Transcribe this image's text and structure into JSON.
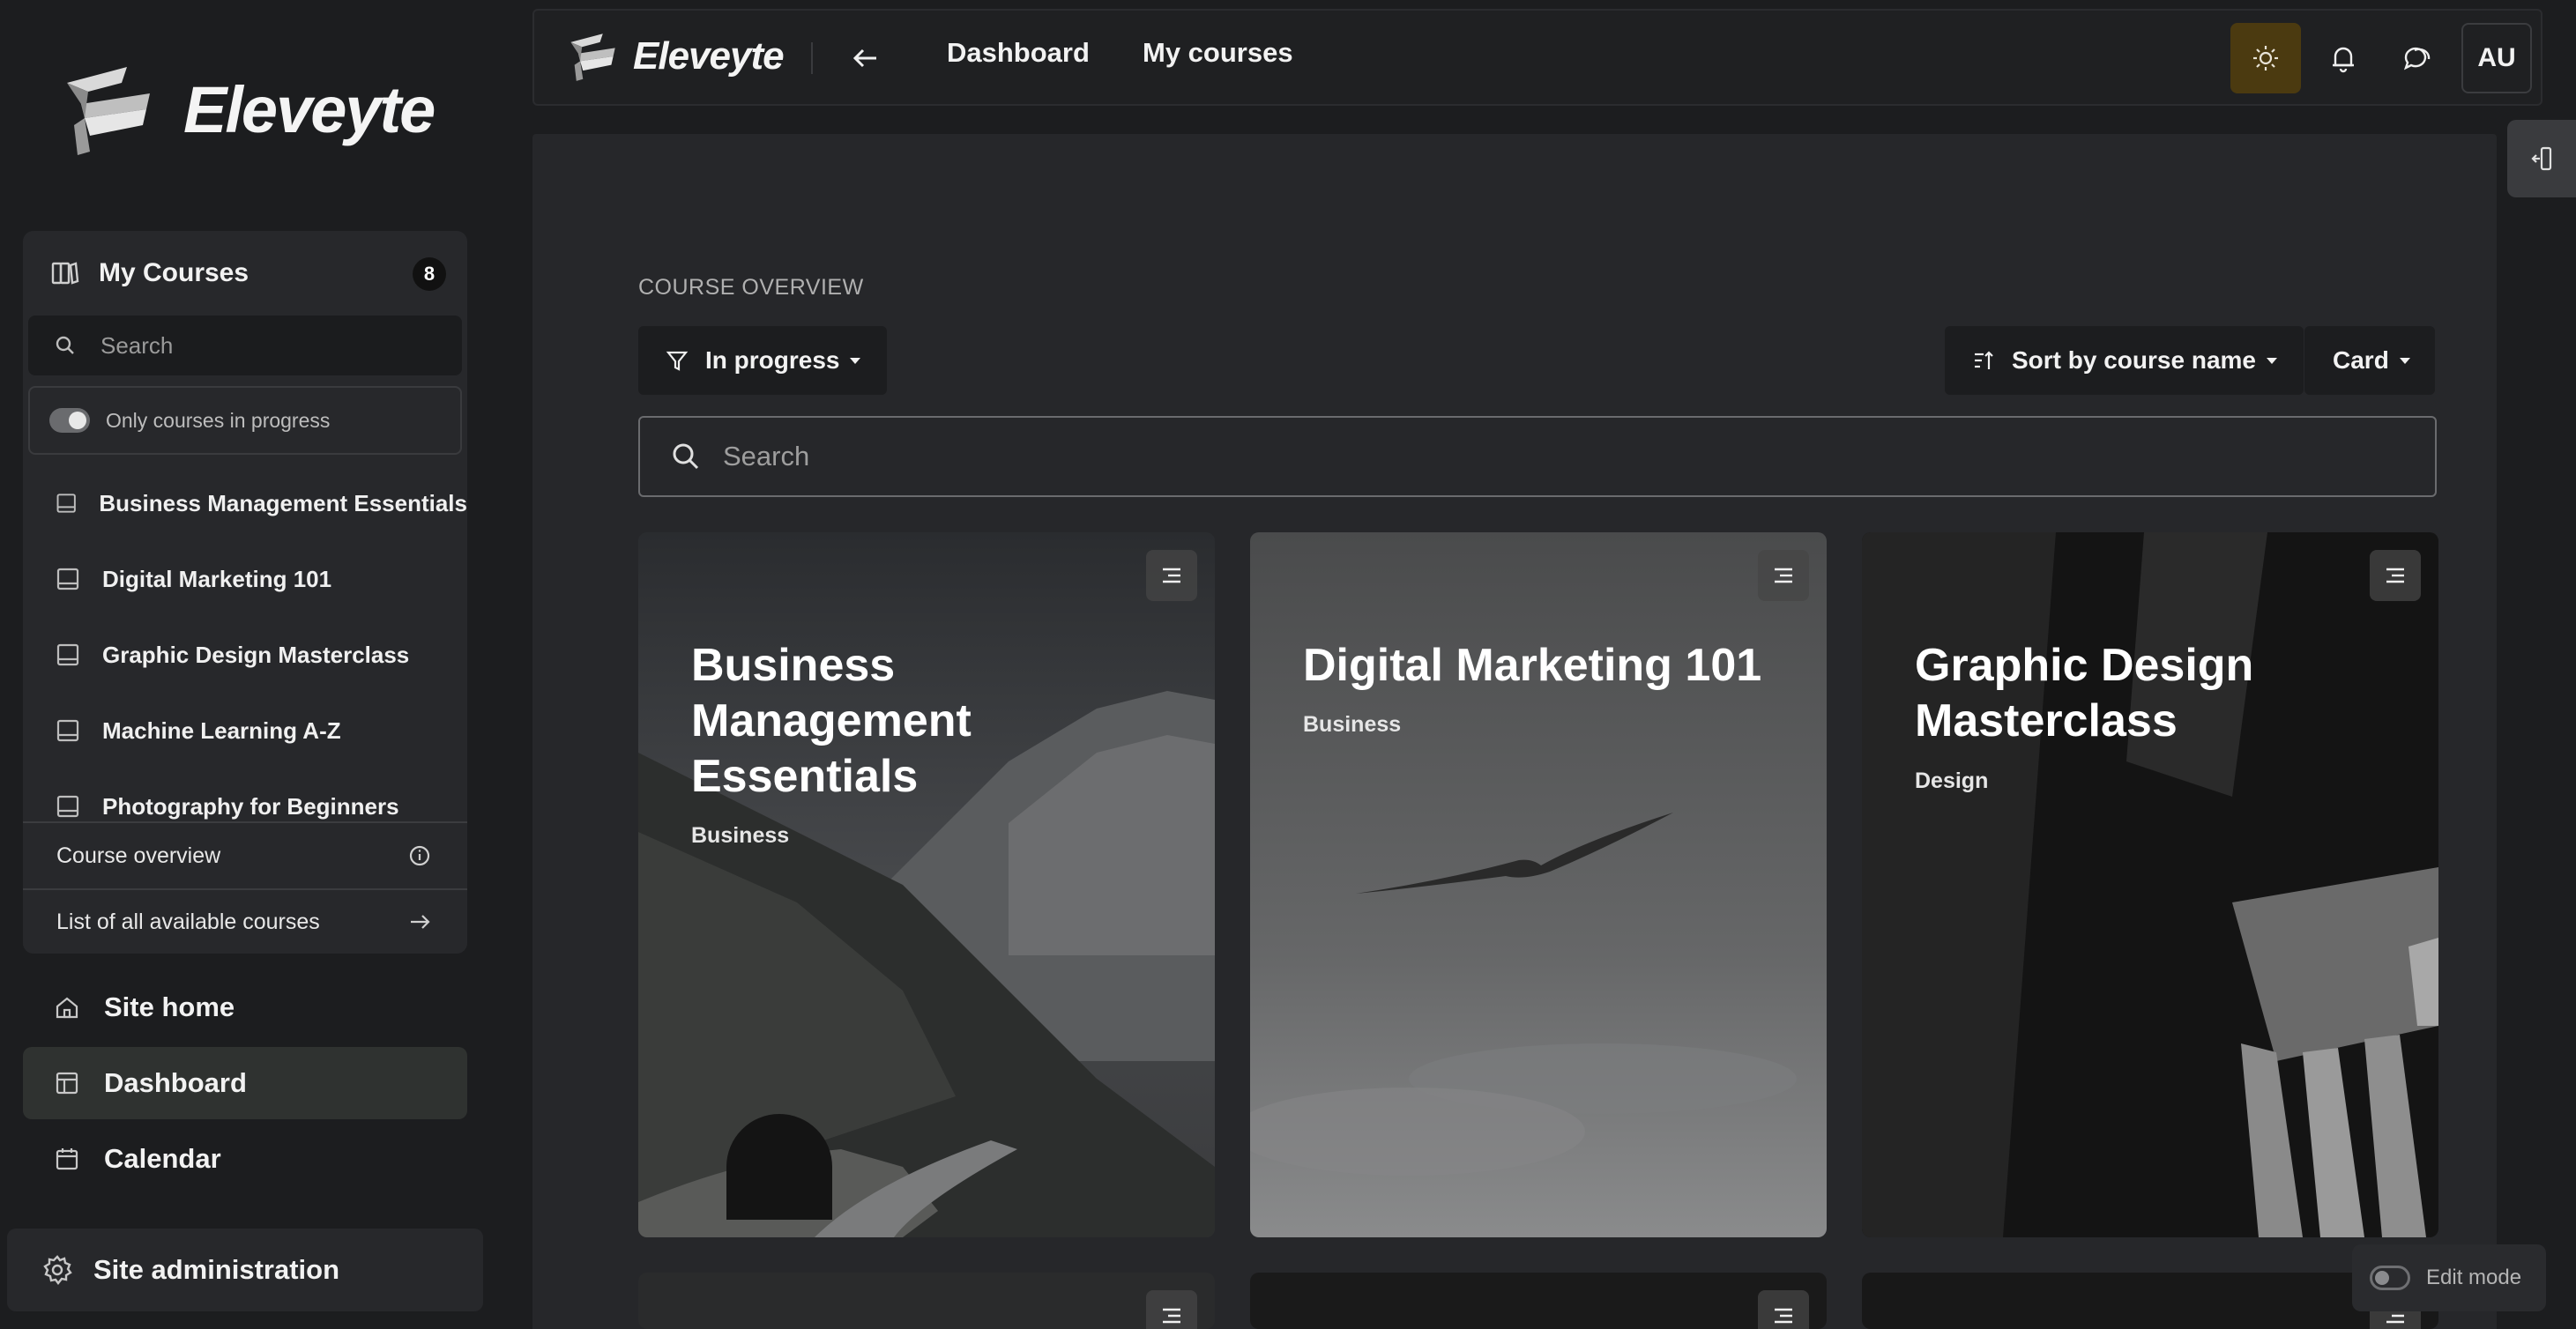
{
  "brand": {
    "name": "Eleveyte"
  },
  "sidebar": {
    "my_courses": {
      "title": "My Courses",
      "count": "8",
      "search_placeholder": "Search",
      "toggle_label": "Only courses in progress",
      "items": [
        {
          "label": "Business Management Essentials"
        },
        {
          "label": "Digital Marketing 101"
        },
        {
          "label": "Graphic Design Masterclass"
        },
        {
          "label": "Machine Learning A-Z"
        },
        {
          "label": "Photography for Beginners"
        }
      ],
      "footer": {
        "overview_label": "Course overview",
        "all_courses_label": "List of all available courses"
      }
    },
    "nav": {
      "site_home": "Site home",
      "dashboard": "Dashboard",
      "calendar": "Calendar"
    },
    "site_admin": "Site administration"
  },
  "topbar": {
    "links": {
      "dashboard": "Dashboard",
      "my_courses": "My courses"
    },
    "avatar_initials": "AU",
    "theme_accent": "#4b3a10"
  },
  "main": {
    "section_title": "COURSE OVERVIEW",
    "filter_label": "In progress",
    "sort_label": "Sort by course name",
    "view_label": "Card",
    "search_placeholder": "Search",
    "cards": [
      {
        "title": "Business Management Essentials",
        "category": "Business",
        "image": "mountain-road-tunnel"
      },
      {
        "title": "Digital Marketing 101",
        "category": "Business",
        "image": "bird-in-sky"
      },
      {
        "title": "Graphic Design Masterclass",
        "category": "Design",
        "image": "fork-closeup"
      }
    ]
  },
  "edit_mode": {
    "label": "Edit mode"
  },
  "icons": {
    "courses": "book-stack-icon",
    "search": "search-icon",
    "course_item": "book-icon",
    "info": "info-icon",
    "arrow_right": "arrow-right-icon",
    "home": "home-icon",
    "dashboard": "dashboard-icon",
    "calendar": "calendar-icon",
    "settings": "gear-icon",
    "back": "arrow-left-icon",
    "theme": "sun-icon",
    "notifications": "bell-icon",
    "messages": "chat-icon",
    "filter": "filter-icon",
    "sort": "sort-icon",
    "card_menu": "menu-lines-icon",
    "drawer": "drawer-toggle-icon"
  }
}
